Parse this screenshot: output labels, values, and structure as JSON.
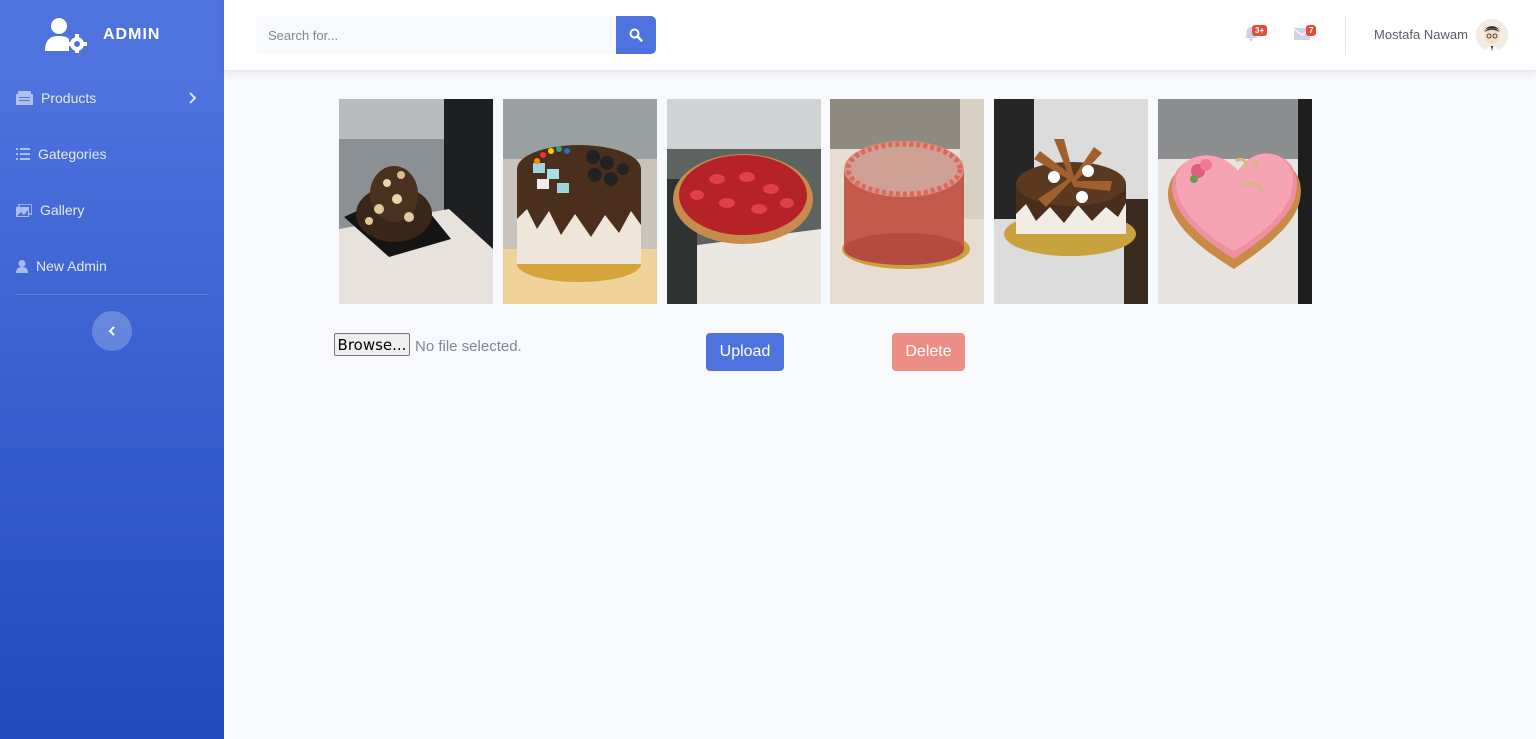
{
  "brand": {
    "title": "ADMIN",
    "icon": "users-cog-icon"
  },
  "sidebar": {
    "items": [
      {
        "label": "Products",
        "icon": "box-icon",
        "has_chevron": true
      },
      {
        "label": "Gategories",
        "icon": "list-icon"
      },
      {
        "label": "Gallery",
        "icon": "images-icon"
      },
      {
        "label": "New Admin",
        "icon": "user-icon"
      }
    ],
    "toggle_icon": "chevron-left-icon"
  },
  "topbar": {
    "search": {
      "placeholder": "Search for...",
      "value": ""
    },
    "alerts": {
      "icon": "bell-icon",
      "count": "3+"
    },
    "messages": {
      "icon": "envelope-icon",
      "count": "7"
    },
    "user": {
      "name": "Mostafa Nawam"
    }
  },
  "gallery": {
    "images": [
      {
        "alt": "chocolate profiterole tower"
      },
      {
        "alt": "candy drip cake"
      },
      {
        "alt": "strawberry tart"
      },
      {
        "alt": "pink frosted cake"
      },
      {
        "alt": "chocolate wafer cake"
      },
      {
        "alt": "heart shaped pink cake"
      }
    ]
  },
  "upload": {
    "browse_label": "Browse...",
    "file_status": "No file selected.",
    "upload_label": "Upload",
    "delete_label": "Delete"
  },
  "colors": {
    "primary": "#4e73df",
    "danger": "#e74a3b",
    "delete_faded": "#ec8e86"
  }
}
